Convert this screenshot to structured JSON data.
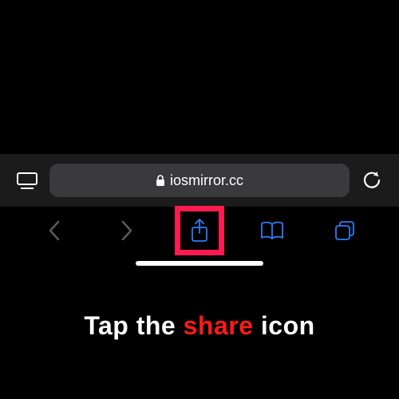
{
  "browser": {
    "url": "iosmirror.cc"
  },
  "caption": {
    "prefix": "Tap the ",
    "highlight": "share",
    "suffix": " icon"
  }
}
